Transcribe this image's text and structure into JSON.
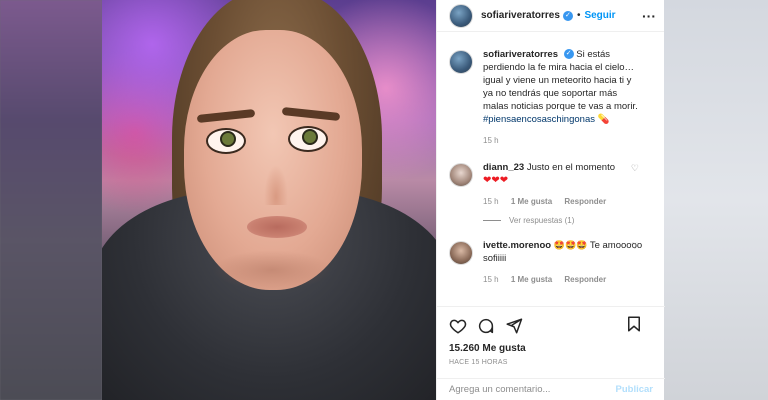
{
  "post": {
    "username": "sofiariveratorres",
    "follow_label": "Seguir",
    "separator": "•",
    "more_icon": "more-horizontal-icon"
  },
  "caption": {
    "username": "sofiariveratorres",
    "text": "Si estás perdiendo la fe mira hacia el cielo… igual y viene un meteorito hacia ti y ya no tendrás que soportar más malas noticias porque te vas a morir.",
    "hashtag": "#piensaencosaschingonas",
    "emoji": "💊",
    "time": "15 h"
  },
  "comments": [
    {
      "username": "diann_23",
      "text": "Justo en el momento",
      "hearts": "❤❤❤",
      "time": "15 h",
      "likes": "1 Me gusta",
      "reply": "Responder",
      "view_replies": "Ver respuestas (1)"
    },
    {
      "username": "ivette.morenoo",
      "emojis": "🤩🤩🤩",
      "text": "Te amooooo sofiiiii",
      "time": "15 h",
      "likes": "1 Me gusta",
      "reply": "Responder"
    }
  ],
  "actions": {
    "likes_count": "15.260 Me gusta",
    "time_ago": "HACE 15 HORAS"
  },
  "comment_input": {
    "placeholder": "Agrega un comentario...",
    "publish_label": "Publicar"
  },
  "colors": {
    "link": "#0095f6",
    "verified": "#3897f0",
    "hashtag": "#00376b",
    "muted": "#8e8e8e"
  }
}
